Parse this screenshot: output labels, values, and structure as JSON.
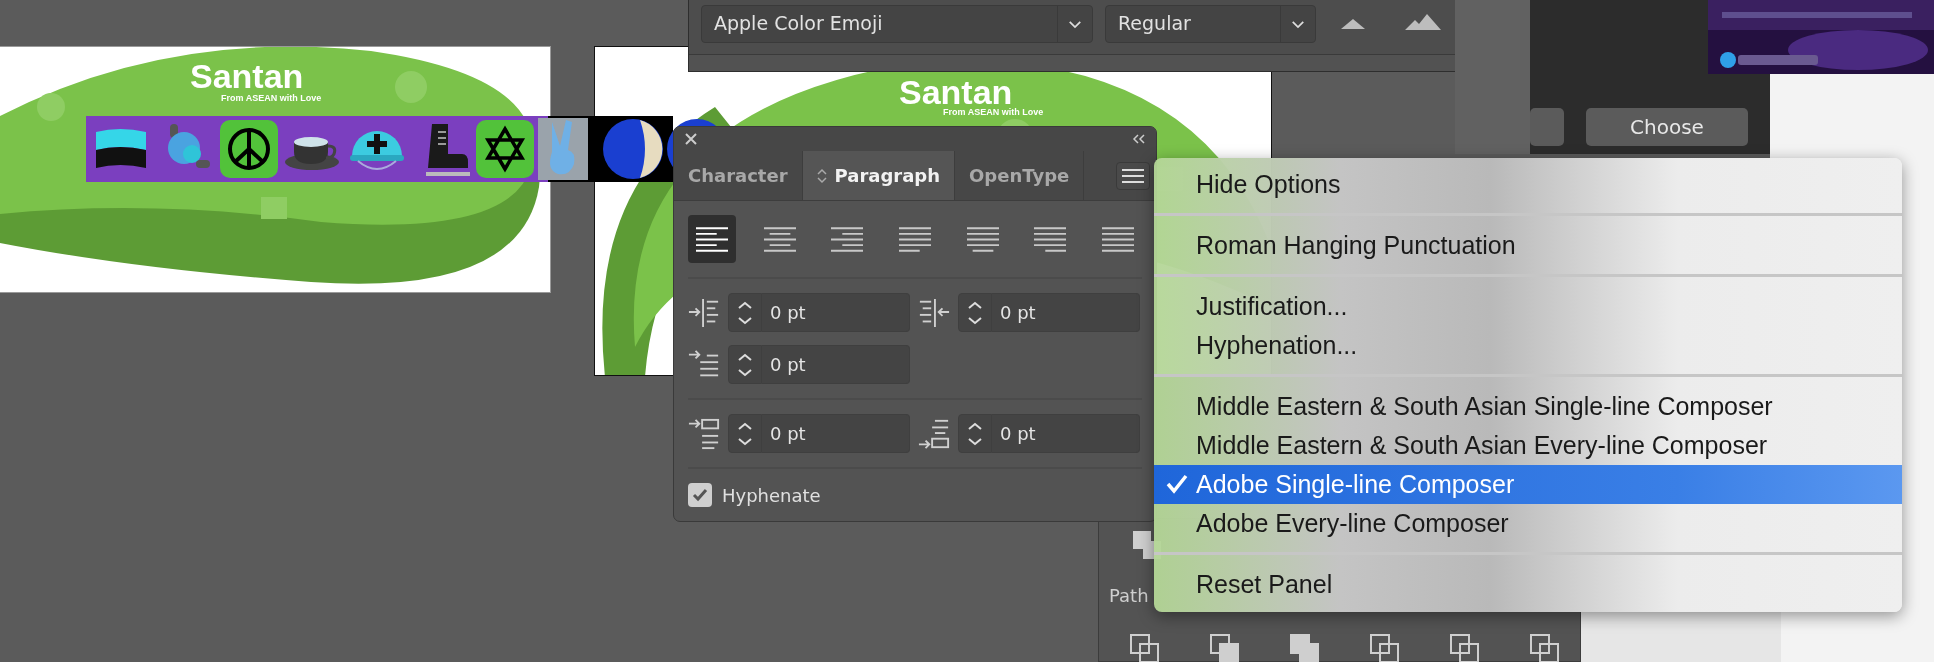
{
  "artboards": [
    {
      "logo": "Santan",
      "tagline": "From ASEAN with Love"
    },
    {
      "logo": "Santan",
      "tagline": "From ASEAN with Love"
    }
  ],
  "character_panel": {
    "font_family": "Apple Color Emoji",
    "font_style": "Regular"
  },
  "file_dialog": {
    "buttons": [
      "Choose"
    ]
  },
  "paragraph_panel": {
    "tabs": [
      {
        "label": "Character",
        "selected": false
      },
      {
        "label": "Paragraph",
        "selected": true
      },
      {
        "label": "OpenType",
        "selected": false
      }
    ],
    "alignments": [
      {
        "kind": "left",
        "selected": true
      },
      {
        "kind": "center",
        "selected": false
      },
      {
        "kind": "right",
        "selected": false
      },
      {
        "kind": "justify_left",
        "selected": false
      },
      {
        "kind": "justify_center",
        "selected": false
      },
      {
        "kind": "justify_right",
        "selected": false
      },
      {
        "kind": "justify_all",
        "selected": false
      }
    ],
    "indent_fields": [
      {
        "kind": "left_indent",
        "value": "0 pt"
      },
      {
        "kind": "right_indent",
        "value": "0 pt"
      },
      {
        "kind": "first_line",
        "value": "0 pt"
      }
    ],
    "spacing_fields": [
      {
        "kind": "space_before",
        "value": "0 pt"
      },
      {
        "kind": "space_after",
        "value": "0 pt"
      }
    ],
    "hyphenate": {
      "label": "Hyphenate",
      "checked": true
    }
  },
  "pathfinder_panel": {
    "title": "Path"
  },
  "panel_menu": {
    "groups": [
      {
        "items": [
          {
            "label": "Hide Options",
            "selected": false,
            "checked": false
          }
        ]
      },
      {
        "items": [
          {
            "label": "Roman Hanging Punctuation",
            "selected": false,
            "checked": false
          }
        ]
      },
      {
        "items": [
          {
            "label": "Justification...",
            "selected": false,
            "checked": false
          },
          {
            "label": "Hyphenation...",
            "selected": false,
            "checked": false
          }
        ]
      },
      {
        "items": [
          {
            "label": "Middle Eastern & South Asian Single-line Composer",
            "selected": false,
            "checked": false
          },
          {
            "label": "Middle Eastern & South Asian Every-line Composer",
            "selected": false,
            "checked": false
          },
          {
            "label": "Adobe Single-line Composer",
            "selected": true,
            "checked": true
          },
          {
            "label": "Adobe Every-line Composer",
            "selected": false,
            "checked": false
          }
        ]
      },
      {
        "items": [
          {
            "label": "Reset Panel",
            "selected": false,
            "checked": false
          }
        ]
      }
    ]
  }
}
